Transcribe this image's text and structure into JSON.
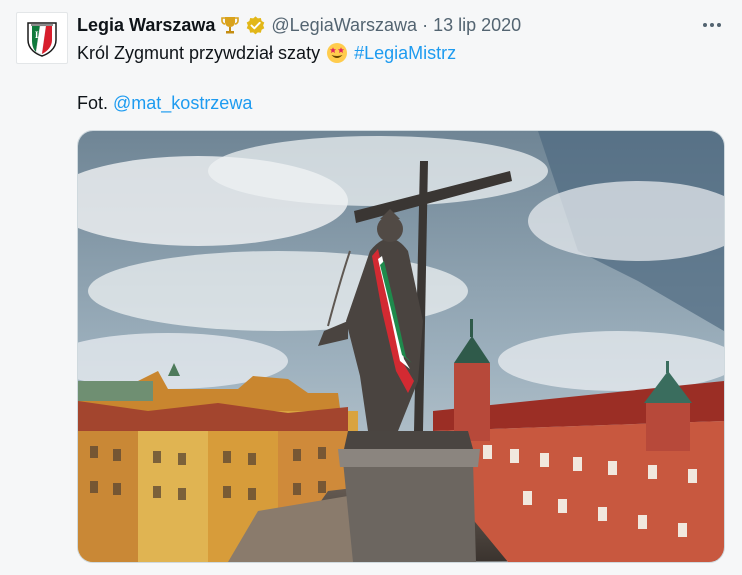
{
  "tweet": {
    "author_name": "Legia Warszawa",
    "handle": "@LegiaWarszawa",
    "separator": "·",
    "date": "13 lip 2020",
    "text_main": "Król Zygmunt przywdział szaty",
    "hashtag": "#LegiaMistrz",
    "photo_credit_prefix": "Fot.",
    "photo_credit_handle": "@mat_kostrzewa",
    "badges": [
      "trophy-icon",
      "verified-gold-icon"
    ],
    "emoji": "star-struck-emoji",
    "colors": {
      "link": "#1d9bf0",
      "secondary_text": "#536471",
      "verified": "#e2b719"
    }
  }
}
